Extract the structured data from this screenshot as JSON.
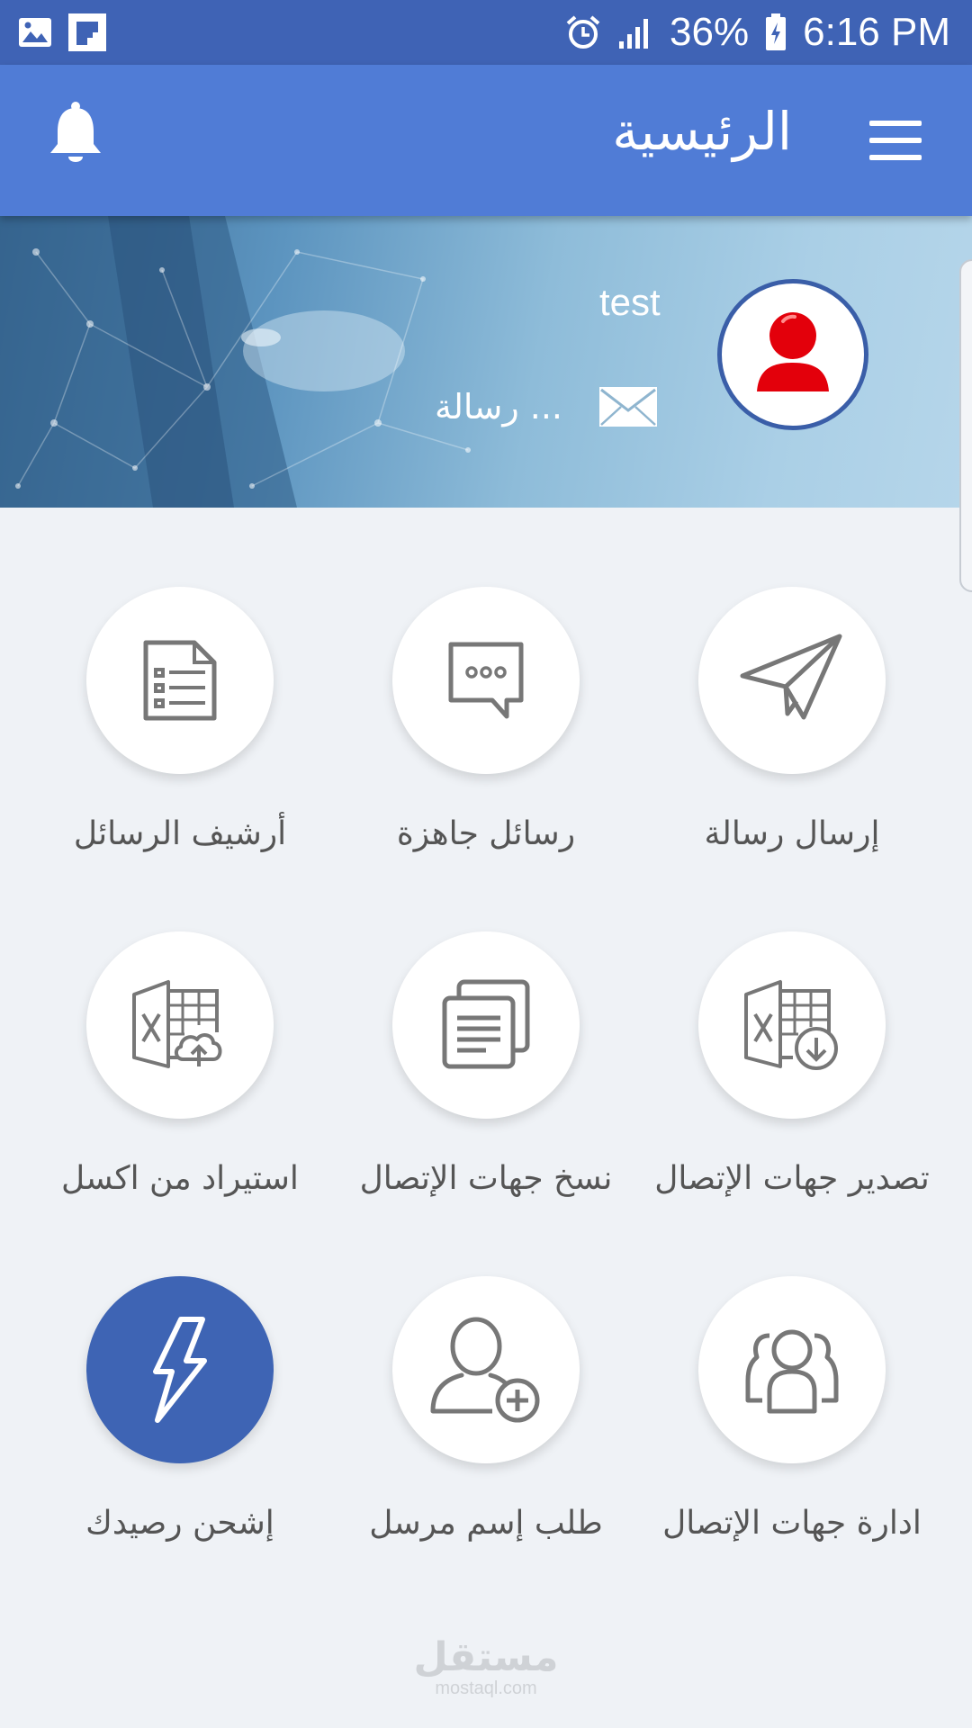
{
  "status_bar": {
    "battery": "36%",
    "time": "6:16 PM",
    "icons": [
      "gallery-icon",
      "flipboard-icon",
      "alarm-icon",
      "signal-icon",
      "battery-charging-icon"
    ]
  },
  "app_bar": {
    "title": "الرئيسية",
    "left_icon": "bell-icon",
    "right_icon": "menu-icon"
  },
  "profile": {
    "name": "test",
    "messages_label": "... رسالة",
    "messages_icon": "mail-icon",
    "avatar_icon": "user-avatar-icon"
  },
  "menu": {
    "items": [
      {
        "label": "إرسال رسالة",
        "icon": "send-icon"
      },
      {
        "label": "رسائل جاهزة",
        "icon": "chat-bubble-icon"
      },
      {
        "label": "أرشيف الرسائل",
        "icon": "document-list-icon"
      },
      {
        "label": "تصدير جهات الإتصال",
        "icon": "excel-export-icon"
      },
      {
        "label": "نسخ جهات الإتصال",
        "icon": "copy-icon"
      },
      {
        "label": "استيراد من اكسل",
        "icon": "excel-import-icon"
      },
      {
        "label": "ادارة جهات الإتصال",
        "icon": "contacts-group-icon"
      },
      {
        "label": "طلب إسم مرسل",
        "icon": "add-user-icon"
      },
      {
        "label": "إشحن رصيدك",
        "icon": "lightning-icon"
      }
    ]
  },
  "watermark": {
    "arabic": "مستقل",
    "latin": "mostaql.com"
  },
  "colors": {
    "status_bar": "#3f63b5",
    "app_bar": "#507cd6",
    "accent": "#3e64b4",
    "avatar": "#e3000b",
    "background": "#eff2f6"
  }
}
